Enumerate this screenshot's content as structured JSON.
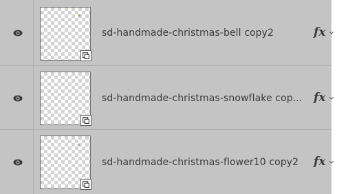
{
  "layers_panel": {
    "layers": [
      {
        "name": "sd-handmade-christmas-bell copy2",
        "visibility_icon": "eye-icon",
        "thumbnail_icon": "transparent-thumbnail-icon",
        "smart_object_icon": "smart-object-badge-icon",
        "effects_label": "fx",
        "thumbnail_accent": "#8aa04a"
      },
      {
        "name": "sd-handmade-christmas-snowflake cop...",
        "visibility_icon": "eye-icon",
        "thumbnail_icon": "transparent-thumbnail-icon",
        "smart_object_icon": "smart-object-badge-icon",
        "effects_label": "fx",
        "thumbnail_accent": ""
      },
      {
        "name": "sd-handmade-christmas-flower10 copy2",
        "visibility_icon": "eye-icon",
        "thumbnail_icon": "transparent-thumbnail-icon",
        "smart_object_icon": "smart-object-badge-icon",
        "effects_label": "fx",
        "thumbnail_accent": "#7ab88a"
      }
    ]
  },
  "colors": {
    "panel_bg": "#c4c4c4",
    "text": "#3a3a3a",
    "separator": "#a9a9a9"
  }
}
